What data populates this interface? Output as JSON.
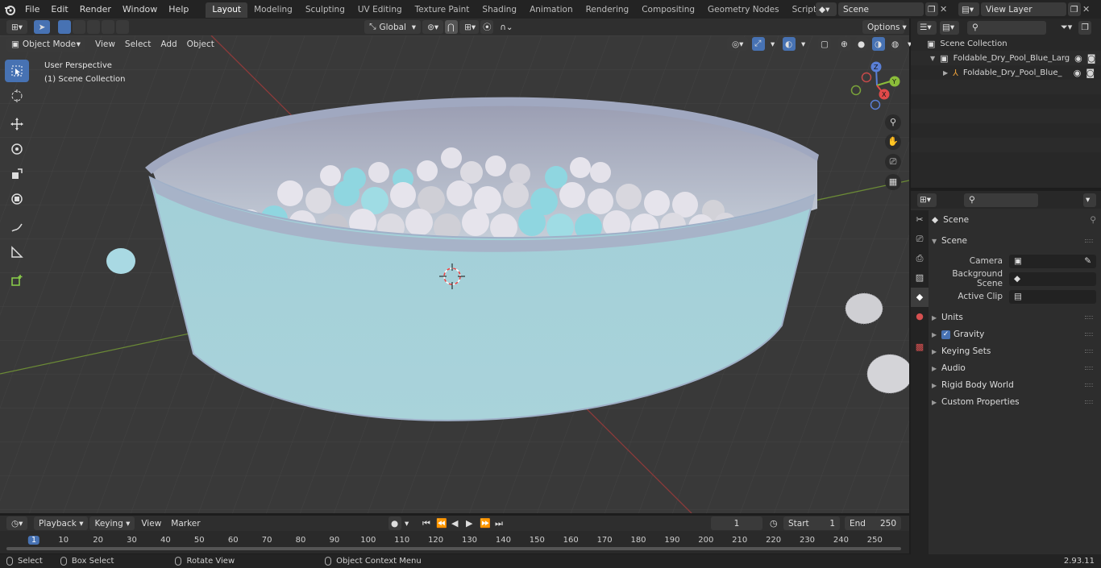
{
  "topbar": {
    "menus": [
      "File",
      "Edit",
      "Render",
      "Window",
      "Help"
    ],
    "workspaces": [
      "Layout",
      "Modeling",
      "Sculpting",
      "UV Editing",
      "Texture Paint",
      "Shading",
      "Animation",
      "Rendering",
      "Compositing",
      "Geometry Nodes",
      "Scripting"
    ],
    "active_workspace": "Layout",
    "scene": "Scene",
    "view_layer": "View Layer"
  },
  "viewport_header": {
    "transform_orientation": "Global",
    "options_label": "Options",
    "mode": "Object Mode",
    "menus": [
      "View",
      "Select",
      "Add",
      "Object"
    ]
  },
  "viewport": {
    "perspective_label": "User Perspective",
    "collection_label": "(1) Scene Collection",
    "axis_labels": {
      "x": "X",
      "y": "Y",
      "z": "Z"
    }
  },
  "outliner": {
    "root": "Scene Collection",
    "items": [
      {
        "label": "Foldable_Dry_Pool_Blue_Larg"
      },
      {
        "label": "Foldable_Dry_Pool_Blue_"
      }
    ]
  },
  "properties": {
    "context": "Scene",
    "panel_title": "Scene",
    "rows": [
      {
        "label": "Camera"
      },
      {
        "label": "Background Scene"
      },
      {
        "label": "Active Clip"
      }
    ],
    "sections": [
      "Units",
      "Gravity",
      "Keying Sets",
      "Audio",
      "Rigid Body World",
      "Custom Properties"
    ],
    "gravity_checked": true
  },
  "timeline": {
    "menus": [
      "Playback",
      "Keying",
      "View",
      "Marker"
    ],
    "current_frame": "1",
    "start_label": "Start",
    "start": "1",
    "end_label": "End",
    "end": "250",
    "ruler": [
      "1",
      "10",
      "20",
      "30",
      "40",
      "50",
      "60",
      "70",
      "80",
      "90",
      "100",
      "110",
      "120",
      "130",
      "140",
      "150",
      "160",
      "170",
      "180",
      "190",
      "200",
      "210",
      "220",
      "230",
      "240",
      "250"
    ]
  },
  "statusbar": {
    "select": "Select",
    "box_select": "Box Select",
    "rotate_view": "Rotate View",
    "context_menu": "Object Context Menu",
    "version": "2.93.11"
  },
  "colors": {
    "accent": "#4772b3",
    "pool_side": "#a9d3da",
    "pool_rim": "#a0a8c0",
    "ball_blue": "#8fd6e0",
    "ball_white": "#e4e2ea"
  }
}
